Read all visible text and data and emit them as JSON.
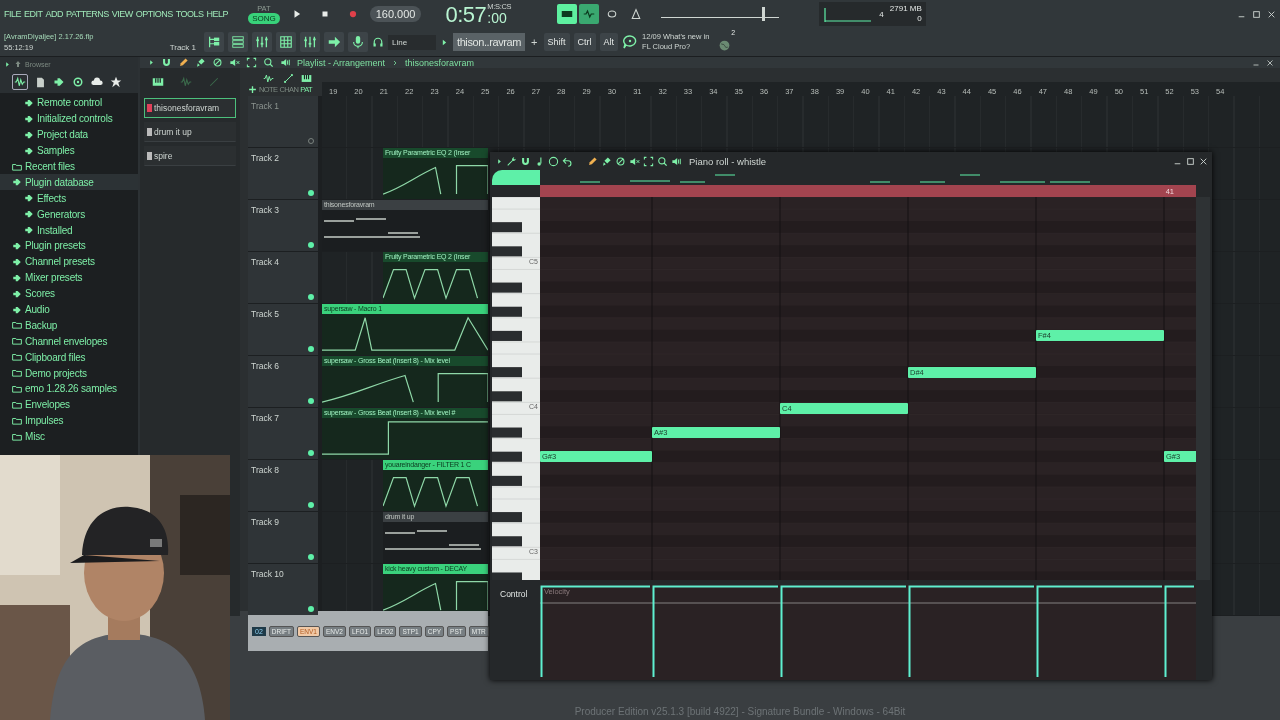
{
  "menu": [
    "FILE",
    "EDIT",
    "ADD",
    "PATTERNS",
    "VIEW",
    "OPTIONS",
    "TOOLS",
    "HELP"
  ],
  "transport": {
    "modes": [
      {
        "label": "PAT",
        "selected": false
      },
      {
        "label": "SONG",
        "selected": true
      }
    ],
    "tempo": "160.000",
    "time": "0:57",
    "time_fraction": ":00",
    "time_unit": "M:S:CS"
  },
  "pitch_slider": {
    "level": 0.85
  },
  "monitor": {
    "cpu": "4",
    "memory": "2791 MB",
    "voices": "0"
  },
  "project": {
    "file": "[AvramDiyaljee] 2.17.26.flp",
    "elapsed": "55:12:19",
    "track": "Track 1"
  },
  "toolbar": {
    "snap": "Line",
    "pattern": "thison..ravram",
    "add": "+",
    "modifiers": [
      "Shift",
      "Ctrl",
      "Alt"
    ],
    "news": "12/09 What's new in FL Cloud Pro?",
    "badge": "2"
  },
  "browser": {
    "title": "Browser",
    "scrolled_children": [
      {
        "label": "Remote control",
        "kind": "item"
      },
      {
        "label": "Initialized controls",
        "kind": "item"
      },
      {
        "label": "Project data",
        "kind": "item"
      },
      {
        "label": "Samples",
        "kind": "item"
      }
    ],
    "items": [
      {
        "label": "Recent files",
        "kind": "folder",
        "selected": false
      },
      {
        "label": "Plugin database",
        "kind": "item",
        "selected": true,
        "children": [
          {
            "label": "Effects",
            "kind": "item",
            "selected": false
          },
          {
            "label": "Generators",
            "kind": "item",
            "selected": false
          },
          {
            "label": "Installed",
            "kind": "item",
            "selected": false
          }
        ]
      },
      {
        "label": "Plugin presets",
        "kind": "item",
        "selected": false
      },
      {
        "label": "Channel presets",
        "kind": "item",
        "selected": false
      },
      {
        "label": "Mixer presets",
        "kind": "item",
        "selected": false
      },
      {
        "label": "Scores",
        "kind": "item",
        "selected": false
      },
      {
        "label": "Audio",
        "kind": "item",
        "selected": false
      },
      {
        "label": "Backup",
        "kind": "folder",
        "selected": false
      },
      {
        "label": "Channel envelopes",
        "kind": "folder",
        "selected": false
      },
      {
        "label": "Clipboard files",
        "kind": "folder",
        "selected": false
      },
      {
        "label": "Demo projects",
        "kind": "folder",
        "selected": false
      },
      {
        "label": "emo 1.28.26 samples",
        "kind": "folder",
        "selected": false
      },
      {
        "label": "Envelopes",
        "kind": "folder",
        "selected": false
      },
      {
        "label": "Impulses",
        "kind": "folder",
        "selected": false
      },
      {
        "label": "Misc",
        "kind": "folder",
        "selected": false
      }
    ]
  },
  "playlist": {
    "title": "Playlist - Arrangement",
    "pattern": "thisonesforavram",
    "tools": [
      {
        "label": "NOTE",
        "selected": false
      },
      {
        "label": "CHAN",
        "selected": false
      },
      {
        "label": "PAT",
        "selected": true
      }
    ],
    "patterns": [
      {
        "label": "thisonesforavram",
        "selected": true
      },
      {
        "label": "drum it up",
        "selected": false
      },
      {
        "label": "spire",
        "selected": false
      }
    ],
    "ruler": [
      "19",
      "20",
      "21",
      "22",
      "23",
      "24",
      "25",
      "26",
      "27",
      "28",
      "29",
      "30",
      "31",
      "32",
      "33",
      "34",
      "35",
      "36",
      "37",
      "38",
      "39",
      "40",
      "41",
      "42",
      "43",
      "44",
      "45",
      "46",
      "47",
      "48",
      "49",
      "50",
      "51",
      "52",
      "53",
      "54"
    ],
    "tracks": [
      {
        "name": "Track 1",
        "enabled": false
      },
      {
        "name": "Track 2",
        "enabled": true,
        "clip": {
          "kind": "automation",
          "label": "Fruity Parametric EQ 2 (Inser",
          "late": true,
          "selected": false
        }
      },
      {
        "name": "Track 3",
        "enabled": true,
        "clip": {
          "kind": "pattern",
          "label": "thisonesforavram",
          "late": false
        }
      },
      {
        "name": "Track 4",
        "enabled": true,
        "clip": {
          "kind": "automation",
          "label": "Fruity Parametric EQ 2 (Inser",
          "late": true,
          "selected": false
        }
      },
      {
        "name": "Track 5",
        "enabled": true,
        "clip": {
          "kind": "automation",
          "label": "supersaw - Macro 1",
          "late": false,
          "selected": true
        }
      },
      {
        "name": "Track 6",
        "enabled": true,
        "clip": {
          "kind": "automation",
          "label": "supersaw - Gross Beat (Insert 8) - Mix level",
          "late": false,
          "selected": false
        }
      },
      {
        "name": "Track 7",
        "enabled": true,
        "clip": {
          "kind": "automation",
          "label": "supersaw - Gross Beat (Insert 8) - Mix level #",
          "late": false,
          "selected": false
        }
      },
      {
        "name": "Track 8",
        "enabled": true,
        "clip": {
          "kind": "automation",
          "label": "youareindanger - FILTER 1 C",
          "late": true,
          "selected": true
        }
      },
      {
        "name": "Track 9",
        "enabled": true,
        "clip": {
          "kind": "pattern",
          "label": "drum it up",
          "late": true
        }
      },
      {
        "name": "Track 10",
        "enabled": true,
        "clip": {
          "kind": "automation",
          "label": "kick heavy custom - DECAY",
          "late": true,
          "selected": true
        }
      }
    ]
  },
  "piano_roll": {
    "title": "Piano roll - whistle",
    "marker": "41",
    "key_labels": [
      "C5",
      "C4",
      "C3"
    ],
    "notes": [
      {
        "label": "G#3"
      },
      {
        "label": "A#3"
      },
      {
        "label": "C4"
      },
      {
        "label": "D#4"
      },
      {
        "label": "F#4"
      },
      {
        "label": "G#3"
      }
    ],
    "control": "Control",
    "control_target": "Velocity"
  },
  "synth": {
    "display": "02",
    "buttons": [
      {
        "label": "DRIFT",
        "selected": false
      },
      {
        "label": "ENV1",
        "selected": true
      },
      {
        "label": "ENV2",
        "selected": false
      },
      {
        "label": "LFO1",
        "selected": false
      },
      {
        "label": "LFO2",
        "selected": false
      },
      {
        "label": "STP1",
        "selected": false
      },
      {
        "label": "CPY",
        "selected": false
      },
      {
        "label": "PST",
        "selected": false
      },
      {
        "label": "MTR",
        "selected": false
      }
    ]
  },
  "status": "Producer Edition v25.1.3 [build 4922] - Signature Bundle - Windows - 64Bit",
  "webcam": {
    "kind": "picture"
  }
}
